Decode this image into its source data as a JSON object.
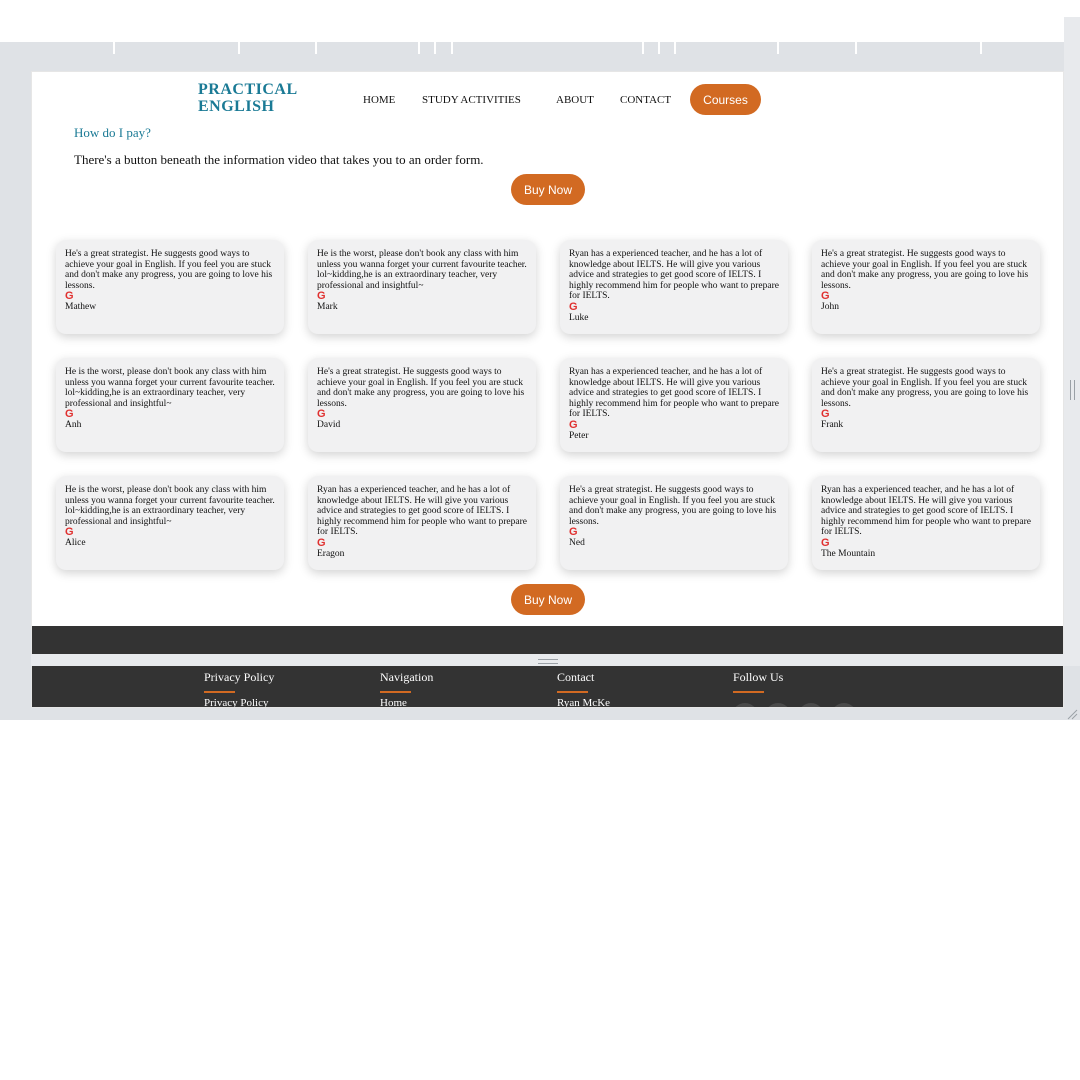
{
  "header": {
    "logo_line1": "PRACTICAL",
    "logo_line2": "ENGLISH",
    "nav": [
      "HOME",
      "STUDY ACTIVITIES",
      "ABOUT",
      "CONTACT"
    ],
    "courses_label": "Courses"
  },
  "faq": {
    "question": "How do I pay?",
    "answer": "There's a button beneath the information video that takes you to an order form."
  },
  "buy_label": "Buy Now",
  "review_icon": "G",
  "reviews": [
    {
      "text": "He's a great strategist. He suggests good ways to achieve your goal in English. If you feel you are stuck and don't make any progress, you are going to love his lessons.",
      "name": "Mathew"
    },
    {
      "text": "He is the worst, please don't book any class with him unless you wanna forget your current favourite teacher. lol~kidding,he is an extraordinary teacher, very professional and insightful~",
      "name": "Mark"
    },
    {
      "text": "Ryan has a experienced teacher, and he has a lot of knowledge about IELTS. He will give you various advice and strategies to get good score of IELTS. I highly recommend him for people who want to prepare for IELTS.",
      "name": "Luke"
    },
    {
      "text": "He's a great strategist. He suggests good ways to achieve your goal in English. If you feel you are stuck and don't make any progress, you are going to love his lessons.",
      "name": "John"
    },
    {
      "text": "He is the worst, please don't book any class with him unless you wanna forget your current favourite teacher. lol~kidding,he is an extraordinary teacher, very professional and insightful~",
      "name": "Anh"
    },
    {
      "text": "He's a great strategist. He suggests good ways to achieve your goal in English. If you feel you are stuck and don't make any progress, you are going to love his lessons.",
      "name": "David"
    },
    {
      "text": "Ryan has a experienced teacher, and he has a lot of knowledge about IELTS. He will give you various advice and strategies to get good score of IELTS. I highly recommend him for people who want to prepare for IELTS.",
      "name": "Peter"
    },
    {
      "text": "He's a great strategist. He suggests good ways to achieve your goal in English. If you feel you are stuck and don't make any progress, you are going to love his lessons.",
      "name": "Frank"
    },
    {
      "text": "He is the worst, please don't book any class with him unless you wanna forget your current favourite teacher. lol~kidding,he is an extraordinary teacher, very professional and insightful~",
      "name": "Alice"
    },
    {
      "text": "Ryan has a experienced teacher, and he has a lot of knowledge about IELTS. He will give you various advice and strategies to get good score of IELTS. I highly recommend him for people who want to prepare for IELTS.",
      "name": "Eragon"
    },
    {
      "text": "He's a great strategist. He suggests good ways to achieve your goal in English. If you feel you are stuck and don't make any progress, you are going to love his lessons.",
      "name": "Ned"
    },
    {
      "text": "Ryan has a experienced teacher, and he has a lot of knowledge about IELTS. He will give you various advice and strategies to get good score of IELTS. I highly recommend him for people who want to prepare for IELTS.",
      "name": "The Mountain"
    }
  ],
  "footer": {
    "columns": [
      {
        "title": "Privacy Policy",
        "first_link": "Privacy Policy"
      },
      {
        "title": "Navigation",
        "first_link": "Home"
      },
      {
        "title": "Contact",
        "first_link": "Ryan McKe"
      },
      {
        "title": "Follow Us"
      }
    ],
    "social_icons": [
      "social-icon-1",
      "social-icon-2",
      "social-icon-3",
      "social-icon-4"
    ]
  },
  "colors": {
    "brand_teal": "#1a7a95",
    "accent_orange": "#d26a22",
    "footer_bg": "#333333",
    "review_icon_red": "#e0302f"
  }
}
